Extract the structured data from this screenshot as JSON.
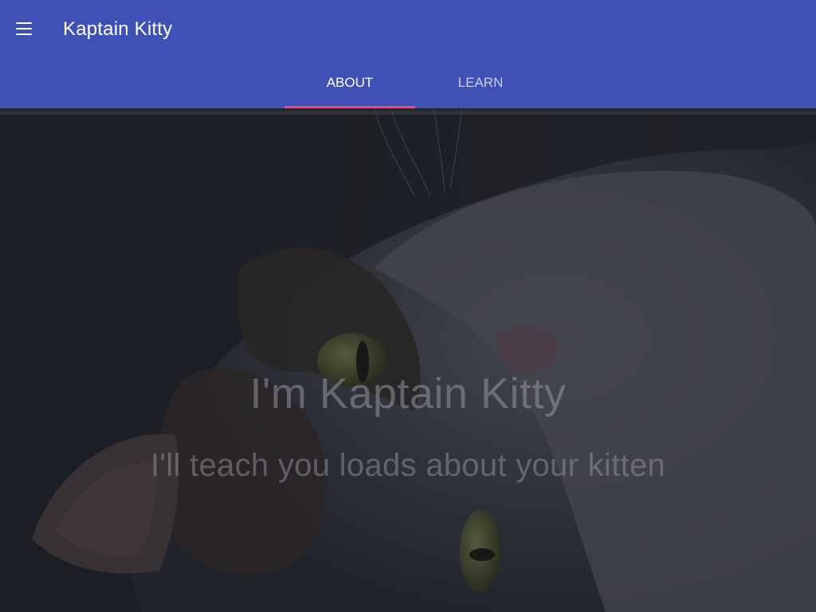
{
  "app_bar": {
    "title": "Kaptain Kitty",
    "menu_icon": "menu-icon",
    "color": "#3f51b5"
  },
  "tabs": [
    {
      "label": "ABOUT",
      "active": true
    },
    {
      "label": "LEARN",
      "active": false
    }
  ],
  "tab_indicator_color": "#ff4081",
  "hero": {
    "title": "I'm Kaptain Kitty",
    "subtitle": "I'll teach you loads about your kitten",
    "background": "kitten-photo"
  }
}
